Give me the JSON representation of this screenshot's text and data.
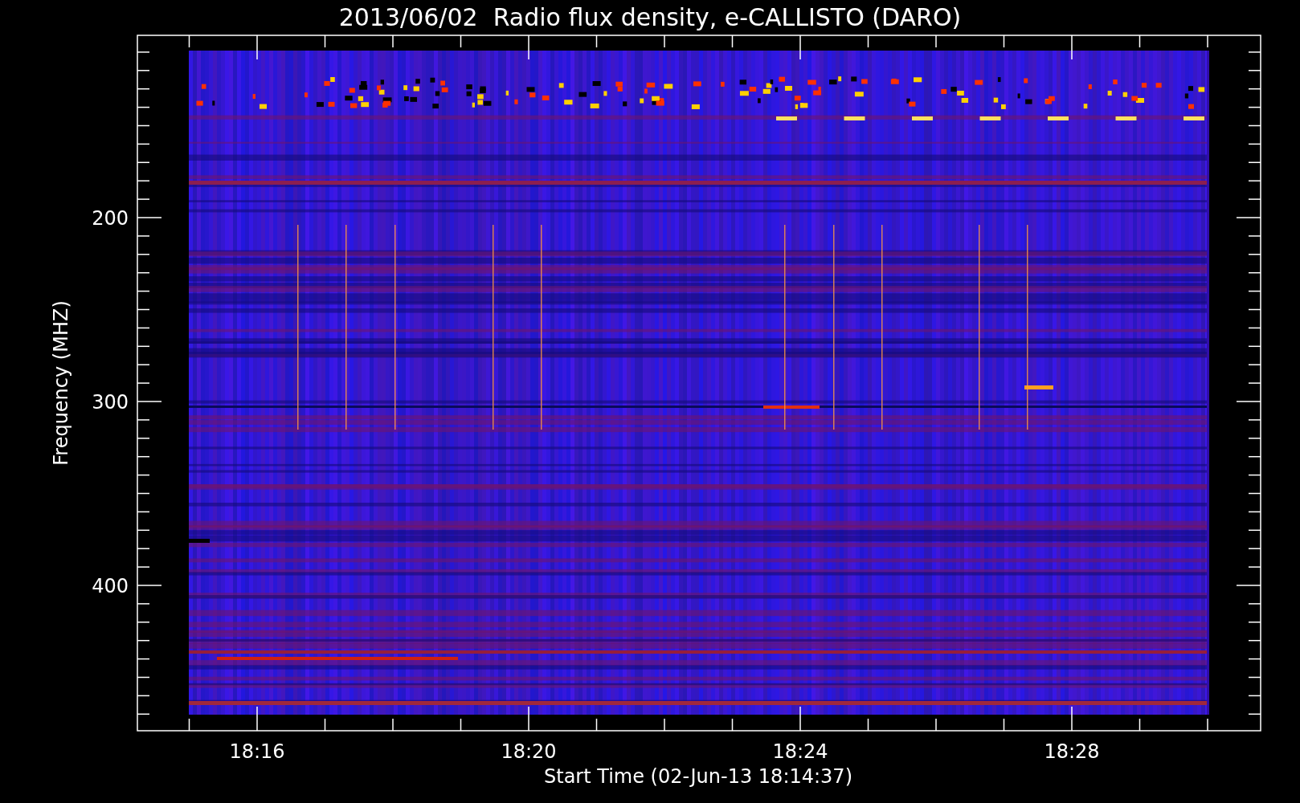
{
  "title": "2013/06/02  Radio flux density, e-CALLISTO (DARO)",
  "y_axis": {
    "label": "Frequency (MHZ)",
    "ticks": [
      "200",
      "300",
      "400"
    ]
  },
  "x_axis": {
    "label": "Start Time (02-Jun-13 18:14:37)",
    "ticks": [
      "18:16",
      "18:20",
      "18:24",
      "18:28"
    ]
  }
}
